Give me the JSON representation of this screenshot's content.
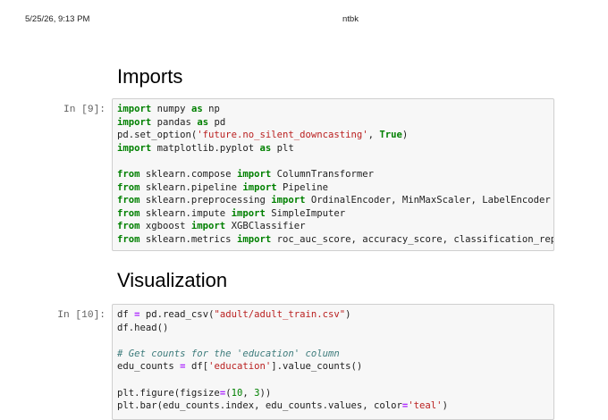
{
  "print_header": {
    "date": "5/25/26, 9:13 PM",
    "title": "ntbk"
  },
  "sections": [
    {
      "heading": "Imports",
      "prompt": "In [9]:",
      "lines": [
        [
          [
            "kw",
            "import"
          ],
          [
            "txt",
            " numpy "
          ],
          [
            "kw",
            "as"
          ],
          [
            "txt",
            " np"
          ]
        ],
        [
          [
            "kw",
            "import"
          ],
          [
            "txt",
            " pandas "
          ],
          [
            "kw",
            "as"
          ],
          [
            "txt",
            " pd"
          ]
        ],
        [
          [
            "txt",
            "pd.set_option("
          ],
          [
            "str",
            "'future.no_silent_downcasting'"
          ],
          [
            "txt",
            ", "
          ],
          [
            "kw",
            "True"
          ],
          [
            "txt",
            ")"
          ]
        ],
        [
          [
            "kw",
            "import"
          ],
          [
            "txt",
            " matplotlib.pyplot "
          ],
          [
            "kw",
            "as"
          ],
          [
            "txt",
            " plt"
          ]
        ],
        [],
        [
          [
            "kw",
            "from"
          ],
          [
            "txt",
            " sklearn.compose "
          ],
          [
            "kw",
            "import"
          ],
          [
            "txt",
            " ColumnTransformer"
          ]
        ],
        [
          [
            "kw",
            "from"
          ],
          [
            "txt",
            " sklearn.pipeline "
          ],
          [
            "kw",
            "import"
          ],
          [
            "txt",
            " Pipeline"
          ]
        ],
        [
          [
            "kw",
            "from"
          ],
          [
            "txt",
            " sklearn.preprocessing "
          ],
          [
            "kw",
            "import"
          ],
          [
            "txt",
            " OrdinalEncoder, MinMaxScaler, LabelEncoder"
          ]
        ],
        [
          [
            "kw",
            "from"
          ],
          [
            "txt",
            " sklearn.impute "
          ],
          [
            "kw",
            "import"
          ],
          [
            "txt",
            " SimpleImputer"
          ]
        ],
        [
          [
            "kw",
            "from"
          ],
          [
            "txt",
            " xgboost "
          ],
          [
            "kw",
            "import"
          ],
          [
            "txt",
            " XGBClassifier"
          ]
        ],
        [
          [
            "kw",
            "from"
          ],
          [
            "txt",
            " sklearn.metrics "
          ],
          [
            "kw",
            "import"
          ],
          [
            "txt",
            " roc_auc_score, accuracy_score, classification_report"
          ]
        ]
      ]
    },
    {
      "heading": "Visualization",
      "prompt": "In [10]:",
      "lines": [
        [
          [
            "txt",
            "df "
          ],
          [
            "op",
            "="
          ],
          [
            "txt",
            " pd.read_csv("
          ],
          [
            "str",
            "\"adult/adult_train.csv\""
          ],
          [
            "txt",
            ")"
          ]
        ],
        [
          [
            "txt",
            "df.head()"
          ]
        ],
        [],
        [
          [
            "com",
            "# Get counts for the 'education' column"
          ]
        ],
        [
          [
            "txt",
            "edu_counts "
          ],
          [
            "op",
            "="
          ],
          [
            "txt",
            " df["
          ],
          [
            "str",
            "'education'"
          ],
          [
            "txt",
            "].value_counts()"
          ]
        ],
        [],
        [
          [
            "txt",
            "plt.figure(figsize"
          ],
          [
            "op",
            "="
          ],
          [
            "txt",
            "("
          ],
          [
            "num",
            "10"
          ],
          [
            "txt",
            ", "
          ],
          [
            "num",
            "3"
          ],
          [
            "txt",
            "))"
          ]
        ],
        [
          [
            "txt",
            "plt.bar(edu_counts.index, edu_counts.values, color"
          ],
          [
            "op",
            "="
          ],
          [
            "str",
            "'teal'"
          ],
          [
            "txt",
            ")"
          ]
        ]
      ]
    }
  ],
  "colors": {
    "keyword": "#008000",
    "operator": "#aa22ff",
    "string": "#ba2121",
    "comment": "#3d7b7b",
    "cell_bg": "#f7f7f7"
  }
}
